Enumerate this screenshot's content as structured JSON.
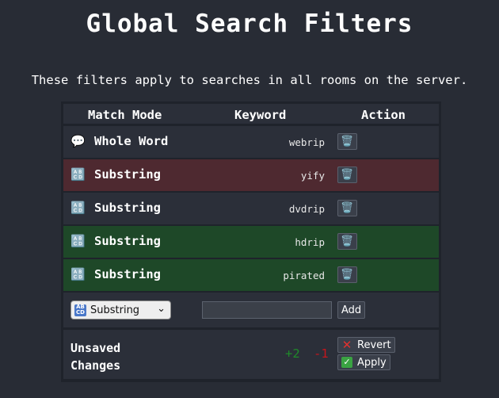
{
  "page": {
    "title": "Global Search Filters",
    "description": "These filters apply to searches in all rooms on the server."
  },
  "table": {
    "headers": {
      "mode": "Match Mode",
      "keyword": "Keyword",
      "action": "Action"
    },
    "rows": [
      {
        "mode": "Whole Word",
        "mode_icon": "speech-bubble-icon",
        "keyword": "webrip",
        "state": "normal"
      },
      {
        "mode": "Substring",
        "mode_icon": "abcd-icon",
        "keyword": "yify",
        "state": "removed"
      },
      {
        "mode": "Substring",
        "mode_icon": "abcd-icon",
        "keyword": "dvdrip",
        "state": "normal"
      },
      {
        "mode": "Substring",
        "mode_icon": "abcd-icon",
        "keyword": "hdrip",
        "state": "added"
      },
      {
        "mode": "Substring",
        "mode_icon": "abcd-icon",
        "keyword": "pirated",
        "state": "added"
      }
    ],
    "colors": {
      "removed": "#4e2930",
      "added": "#1e4828"
    }
  },
  "add_form": {
    "mode_select": "Substring",
    "keyword_value": "",
    "add_label": "Add"
  },
  "pending": {
    "label_line1": "Unsaved",
    "label_line2": "Changes",
    "added": "+2",
    "removed": "-1",
    "revert_label": "Revert",
    "apply_label": "Apply"
  }
}
